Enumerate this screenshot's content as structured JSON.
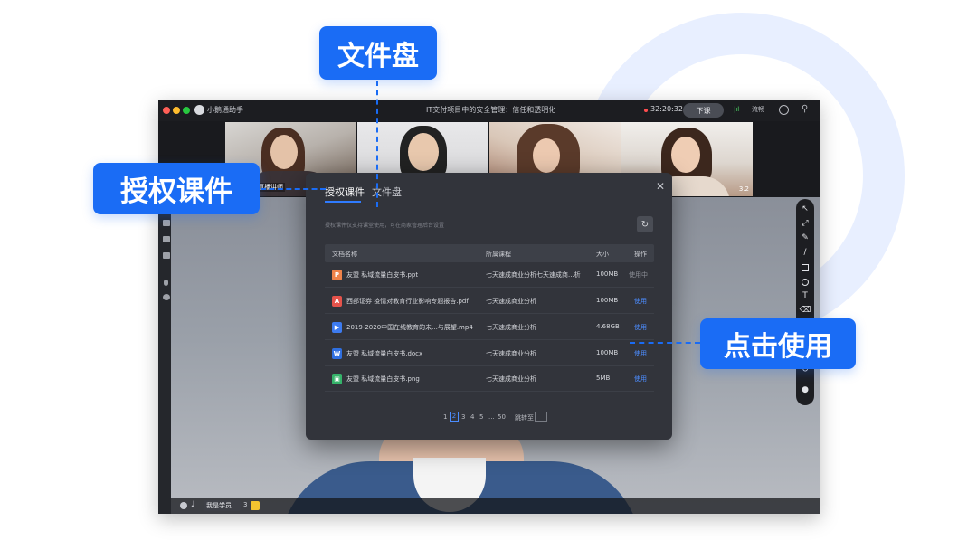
{
  "callouts": {
    "file_disk": "文件盘",
    "authorized_courseware": "授权课件",
    "click_use": "点击使用"
  },
  "window": {
    "app_name": "小鹅通助手",
    "lesson_title": "IT交付项目中的安全管理：信任和透明化",
    "timer": "32:20:32",
    "end_button": "下课",
    "network_label": "流畅"
  },
  "video_tiles": [
    {
      "name": "直播讲师",
      "badge": ""
    },
    {
      "name": "",
      "badge": ""
    },
    {
      "name": "",
      "badge": ""
    },
    {
      "name": "",
      "badge": "3.2"
    }
  ],
  "bottom_bar": {
    "user_label": "我是学员...",
    "count": "3"
  },
  "modal": {
    "tabs": [
      {
        "label": "授权课件",
        "active": true
      },
      {
        "label": "文件盘",
        "active": false
      }
    ],
    "hint": "授权课件仅支持课堂使用，可在商家管理后台设置",
    "columns": [
      "文档名称",
      "所属课程",
      "大小",
      "操作"
    ],
    "rows": [
      {
        "icon": "ppt-icon",
        "icon_char": "P",
        "icon_color": "#f0834a",
        "name": "友盟 私域流量白皮书.ppt",
        "course": "七天速成商业分析七天速成商...析",
        "size": "100MB",
        "action": "使用中",
        "in_use": true
      },
      {
        "icon": "pdf-icon",
        "icon_char": "A",
        "icon_color": "#e5534b",
        "name": "西部证券 疫情对教育行业影响专题报告.pdf",
        "course": "七天速成商业分析",
        "size": "100MB",
        "action": "使用",
        "in_use": false
      },
      {
        "icon": "video-icon",
        "icon_char": "▶",
        "icon_color": "#3d7bf0",
        "name": "2019-2020中国在线教育的未...与展望.mp4",
        "course": "七天速成商业分析",
        "size": "4.68GB",
        "action": "使用",
        "in_use": false
      },
      {
        "icon": "word-icon",
        "icon_char": "W",
        "icon_color": "#2f6fe0",
        "name": "友盟 私域流量白皮书.docx",
        "course": "七天速成商业分析",
        "size": "100MB",
        "action": "使用",
        "in_use": false
      },
      {
        "icon": "image-icon",
        "icon_char": "▣",
        "icon_color": "#35b36a",
        "name": "友盟 私域流量白皮书.png",
        "course": "七天速成商业分析",
        "size": "5MB",
        "action": "使用",
        "in_use": false
      }
    ],
    "pagination": {
      "pages": [
        "1",
        "2",
        "3",
        "4",
        "5",
        "...",
        "50"
      ],
      "current": "2",
      "jump_label": "跳转至"
    }
  },
  "colors": {
    "accent": "#1a6cf5",
    "link": "#4c8dff"
  }
}
